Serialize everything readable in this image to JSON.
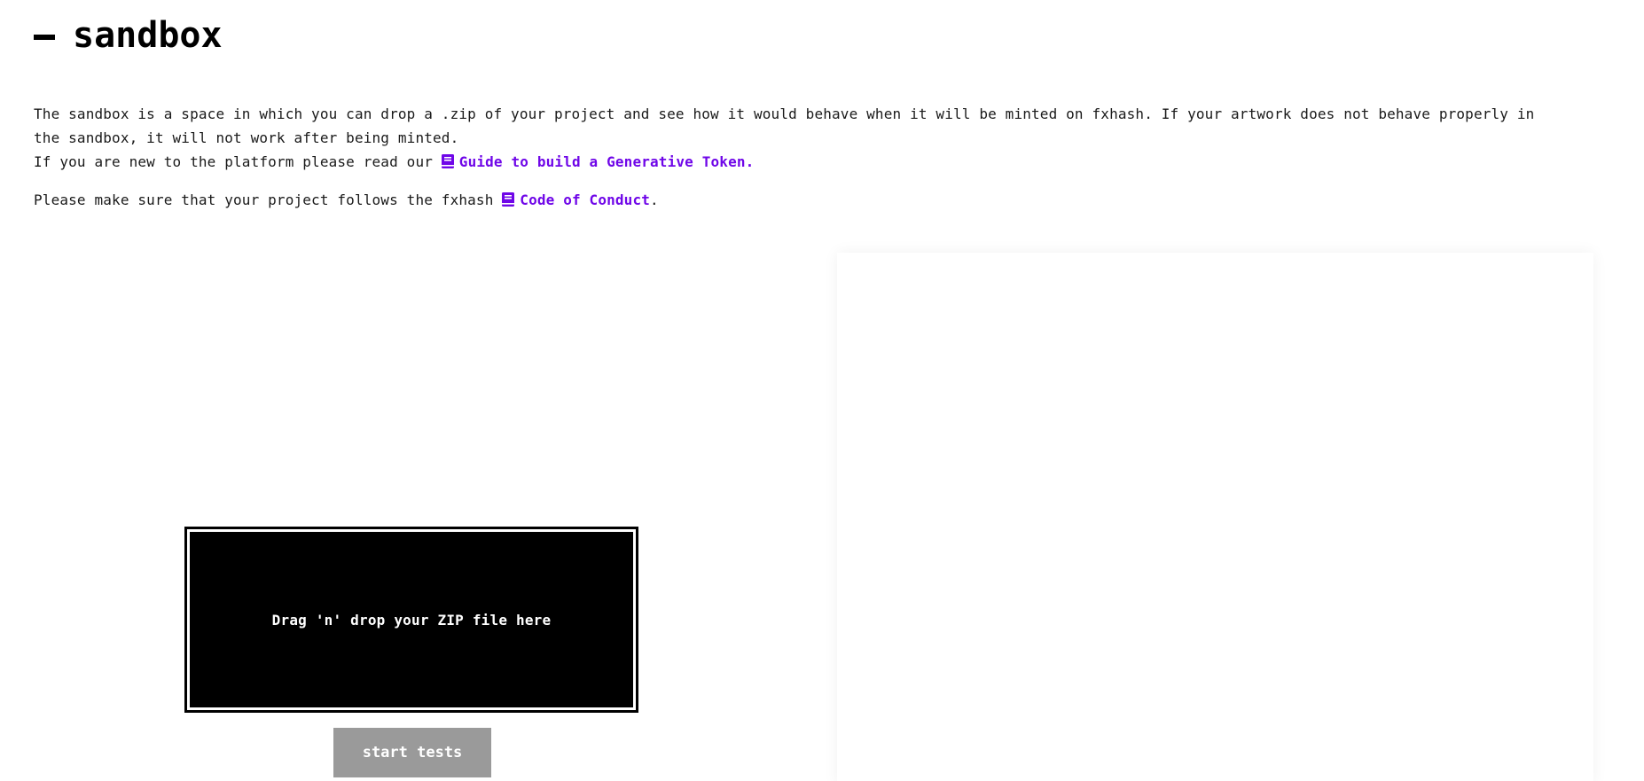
{
  "header": {
    "title": "sandbox"
  },
  "intro": {
    "paragraph1": "The sandbox is a space in which you can drop a .zip of your project and see how it would behave when it will be minted on fxhash. If your artwork does not behave properly in the sandbox, it will not work after being minted.",
    "guide_prefix": "If you are new to the platform please read our ",
    "guide_link": "Guide to build a Generative Token.",
    "conduct_prefix": "Please make sure that your project follows the fxhash ",
    "conduct_link": "Code of Conduct",
    "conduct_suffix": "."
  },
  "dropzone": {
    "label": "Drag 'n' drop your ZIP file here"
  },
  "actions": {
    "start_tests": "start tests"
  },
  "colors": {
    "link": "#6f06e8",
    "button_disabled": "#9a9a9a",
    "dropzone": "#000000"
  },
  "icons": {
    "doc_link_icon": "book-icon"
  }
}
